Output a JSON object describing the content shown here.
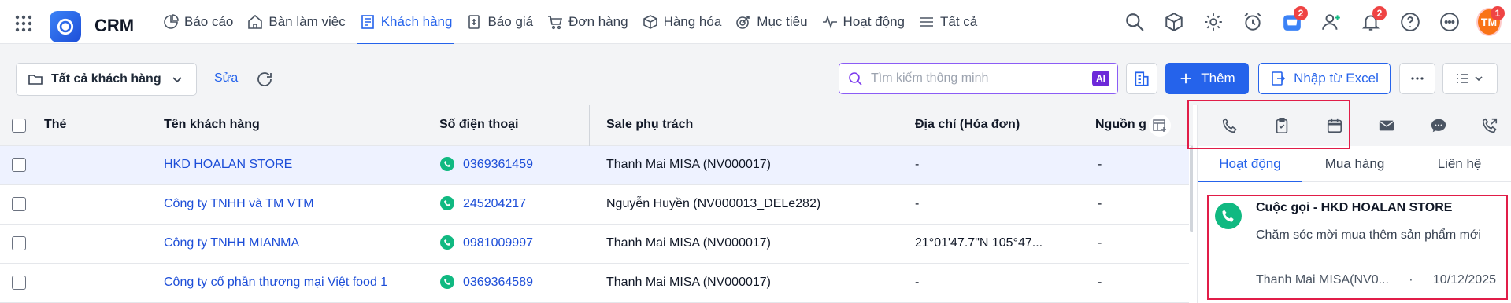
{
  "app": {
    "brand": "CRM",
    "colors": {
      "accent": "#2563eb",
      "success": "#10b981",
      "danger": "#ef4444",
      "highlight": "#e11d48"
    }
  },
  "nav": [
    {
      "label": "Báo cáo",
      "icon": "pie-chart-icon"
    },
    {
      "label": "Bàn làm việc",
      "icon": "home-icon"
    },
    {
      "label": "Khách hàng",
      "icon": "customers-icon",
      "active": true
    },
    {
      "label": "Báo giá",
      "icon": "quote-icon"
    },
    {
      "label": "Đơn hàng",
      "icon": "cart-icon"
    },
    {
      "label": "Hàng hóa",
      "icon": "box-icon"
    },
    {
      "label": "Mục tiêu",
      "icon": "target-icon"
    },
    {
      "label": "Hoạt động",
      "icon": "activity-icon"
    },
    {
      "label": "Tất cả",
      "icon": "menu-icon"
    }
  ],
  "top_icons": {
    "store_badge": "2",
    "notification_badge": "2",
    "avatar_initials": "TM",
    "avatar_badge": "1"
  },
  "toolbar": {
    "filter_label": "Tất cả khách hàng",
    "edit_label": "Sửa",
    "search_placeholder": "Tìm kiếm thông minh",
    "ai_label": "AI",
    "add_label": "Thêm",
    "import_label": "Nhập từ Excel"
  },
  "table": {
    "columns": {
      "tag": "Thẻ",
      "name": "Tên khách hàng",
      "phone": "Số điện thoại",
      "sale": "Sale phụ trách",
      "address": "Địa chỉ (Hóa đơn)",
      "source": "Nguồn g"
    },
    "rows": [
      {
        "name": "HKD HOALAN STORE",
        "phone": "0369361459",
        "sale": "Thanh Mai MISA (NV000017)",
        "address": "-",
        "source": "-",
        "selected": true
      },
      {
        "name": "Công ty TNHH và TM VTM",
        "phone": "245204217",
        "sale": "Nguyễn Huyền (NV000013_DELe282)",
        "address": "-",
        "source": "-"
      },
      {
        "name": "Công ty TNHH MIANMA",
        "phone": "0981009997",
        "sale": "Thanh Mai MISA (NV000017)",
        "address": "21°01'47.7\"N 105°47...",
        "source": "-"
      },
      {
        "name": "Công ty cổ phần thương mại Việt food 1",
        "phone": "0369364589",
        "sale": "Thanh Mai MISA (NV000017)",
        "address": "-",
        "source": "-"
      }
    ]
  },
  "panel": {
    "actions": [
      "phone-icon",
      "task-icon",
      "calendar-icon",
      "email-icon",
      "chat-icon",
      "call-out-icon"
    ],
    "tabs": [
      "Hoạt động",
      "Mua hàng",
      "Liên hệ"
    ],
    "activity": {
      "title": "Cuộc gọi - HKD HOALAN STORE",
      "description": "Chăm sóc mời mua thêm sản phẩm mới",
      "owner": "Thanh Mai MISA(NV0...",
      "separator": "·",
      "date": "10/12/2025"
    }
  }
}
